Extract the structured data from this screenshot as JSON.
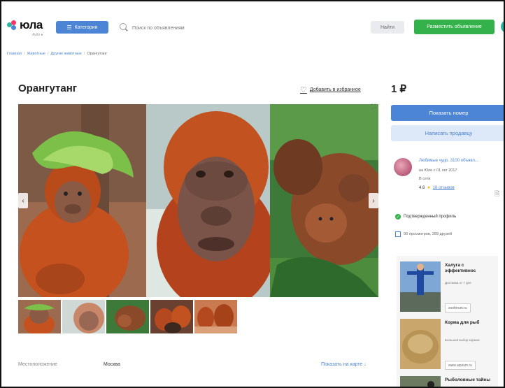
{
  "header": {
    "logo_text": "юла",
    "logo_sub": "Avito ●",
    "categories_label": "Категории",
    "search_placeholder": "Поиск по объявлениям",
    "find_label": "Найти",
    "post_label": "Разместить объявление"
  },
  "breadcrumb": [
    "Главная",
    "Животные",
    "Другие животные",
    "Орангутанг"
  ],
  "listing": {
    "title": "Орангутанг",
    "favorite_label": "Добавить в избранное",
    "price": "1 ₽"
  },
  "actions": {
    "show_phone": "Показать номер",
    "write_seller": "Написать продавцу"
  },
  "seller": {
    "name": "Любимые чудо. 3100 объявл...",
    "since": "на Юле с 01 окт 2017",
    "online": "В сети",
    "rating": "4.6",
    "reviews": "16 отзывов"
  },
  "verified_label": "Подтвержденный профиль",
  "stats_label": "90 просмотров, 289 друзей",
  "location": {
    "label": "Местоположение",
    "value": "Москва",
    "map_link": "Показать на карте ↓"
  },
  "ads": [
    {
      "title": "Халуга с эффективнос",
      "desc": "Доставка от 7 дня",
      "source": "zooforum.ru"
    },
    {
      "title": "Корма для рыб",
      "desc": "Большой выбор кормов",
      "source": "www.aqvium.ru"
    },
    {
      "title": "Рыболовные тайны",
      "desc": "",
      "source": ""
    }
  ],
  "colors": {
    "accent": "#4c84d6",
    "green": "#34b14a",
    "star": "#f2b600"
  },
  "icons": [
    "search-icon",
    "heart-icon",
    "expand-icon",
    "chevron-left-icon",
    "chevron-right-icon",
    "check-icon",
    "document-icon"
  ]
}
